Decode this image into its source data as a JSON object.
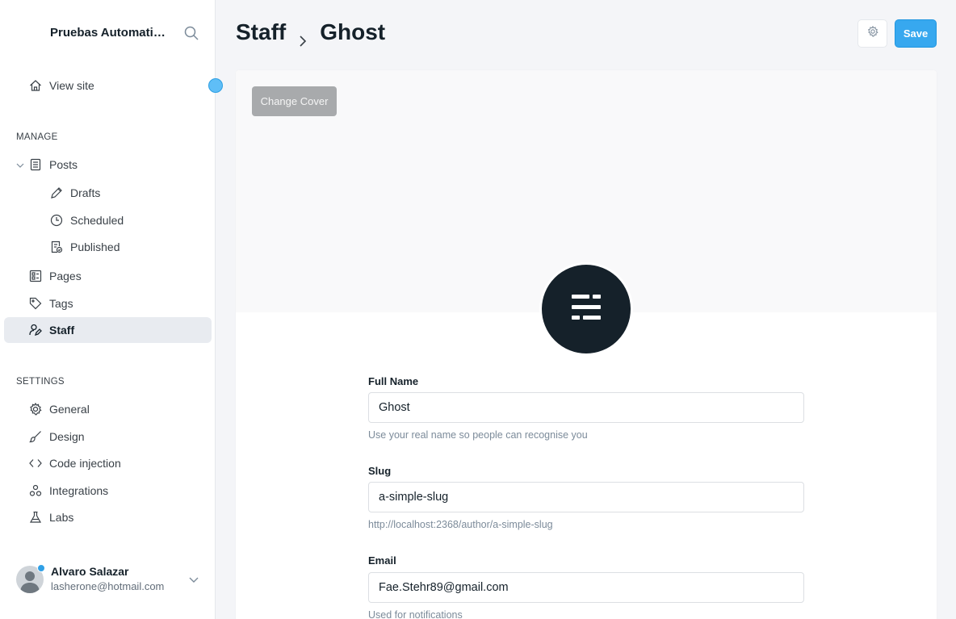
{
  "sidebar": {
    "brand": "Pruebas Automatizadas",
    "view_site": "View site",
    "manage_label": "MANAGE",
    "settings_label": "SETTINGS",
    "posts": "Posts",
    "drafts": "Drafts",
    "scheduled": "Scheduled",
    "published": "Published",
    "pages": "Pages",
    "tags": "Tags",
    "staff": "Staff",
    "general": "General",
    "design": "Design",
    "code_injection": "Code injection",
    "integrations": "Integrations",
    "labs": "Labs"
  },
  "user": {
    "name": "Alvaro Salazar",
    "email": "lasherone@hotmail.com"
  },
  "header": {
    "crumb_parent": "Staff",
    "crumb_current": "Ghost",
    "save_label": "Save"
  },
  "cover": {
    "change_cover_label": "Change Cover"
  },
  "form": {
    "full_name_label": "Full Name",
    "full_name_value": "Ghost",
    "full_name_help": "Use your real name so people can recognise you",
    "slug_label": "Slug",
    "slug_value": "a-simple-slug",
    "slug_help": "http://localhost:2368/author/a-simple-slug",
    "email_label": "Email",
    "email_value": "Fae.Stehr89@gmail.com",
    "email_help": "Used for notifications"
  },
  "colors": {
    "accent": "#37a8ef",
    "dark": "#15212a",
    "sidebar_active": "#e8ebf0"
  }
}
